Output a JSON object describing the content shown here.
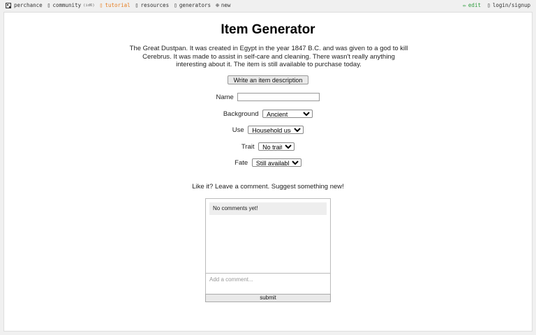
{
  "nav": {
    "left": [
      {
        "label": "perchance",
        "icon": "dice-icon"
      },
      {
        "label": "community",
        "icon": "chat-icon",
        "badge": "(id6)"
      },
      {
        "label": "tutorial",
        "icon": "book-icon",
        "color": "#e67e22"
      },
      {
        "label": "resources",
        "icon": "info-icon"
      },
      {
        "label": "generators",
        "icon": "list-icon"
      },
      {
        "label": "new",
        "icon": "plus-circle-icon"
      }
    ],
    "right": [
      {
        "label": "edit",
        "icon": "pencil-icon",
        "color": "#2e9d3e"
      },
      {
        "label": "login/signup",
        "icon": "user-icon"
      }
    ]
  },
  "page": {
    "title": "Item Generator",
    "description": "The Great Dustpan. It was created in Egypt in the year 1847 B.C. and was given to a god to kill Cerebrus. It was made to assist in self-care and cleaning. There wasn't really anything interesting about it. The item is still available to purchase today.",
    "generate_button": "Write an item description"
  },
  "form": {
    "name": {
      "label": "Name",
      "value": ""
    },
    "background": {
      "label": "Background",
      "value": "Ancient"
    },
    "use": {
      "label": "Use",
      "value": "Household use"
    },
    "trait": {
      "label": "Trait",
      "value": "No trait"
    },
    "fate": {
      "label": "Fate",
      "value": "Still available"
    }
  },
  "comments": {
    "cta": "Like it? Leave a comment. Suggest something new!",
    "empty_text": "No comments yet!",
    "placeholder": "Add a comment...",
    "submit_label": "submit"
  }
}
